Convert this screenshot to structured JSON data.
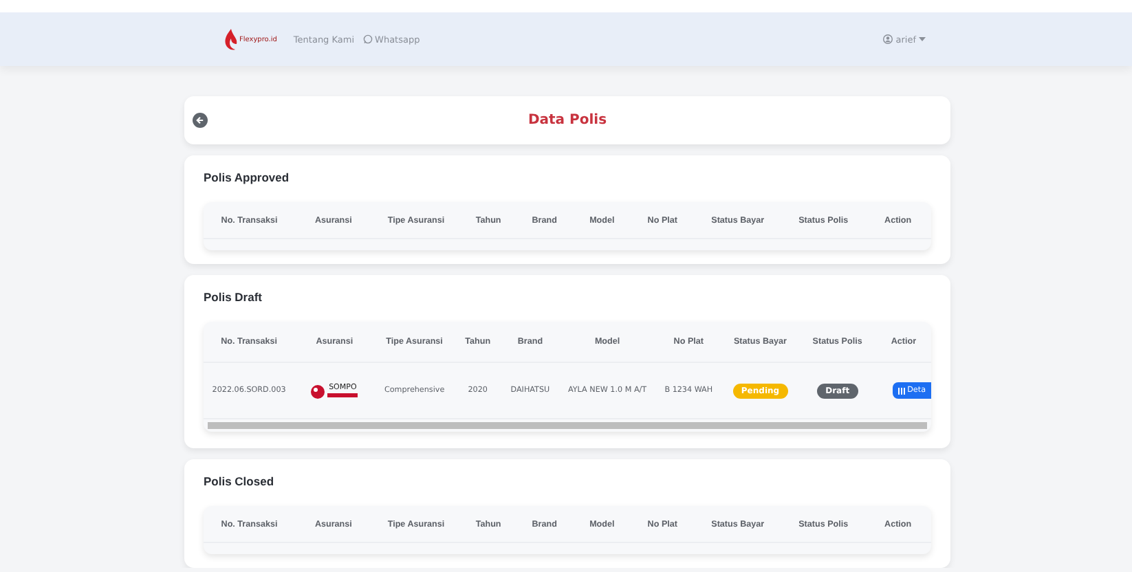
{
  "navbar": {
    "logo_text": "Flexypro.id",
    "links": [
      {
        "label": "Tentang Kami"
      },
      {
        "label": "Whatsapp"
      }
    ],
    "user": "arief"
  },
  "page_title": "Data Polis",
  "sections": [
    {
      "title": "Polis Approved",
      "columns": [
        "No. Transaksi",
        "Asuransi",
        "Tipe Asuransi",
        "Tahun",
        "Brand",
        "Model",
        "No Plat",
        "Status Bayar",
        "Status Polis",
        "Action"
      ]
    },
    {
      "title": "Polis Draft",
      "columns": [
        "No. Transaksi",
        "Asuransi",
        "Tipe Asuransi",
        "Tahun",
        "Brand",
        "Model",
        "No Plat",
        "Status Bayar",
        "Status Polis",
        "Actior"
      ],
      "rows": [
        {
          "no_transaksi": "2022.06.SORD.003",
          "asuransi": "SOMPO",
          "tipe": "Comprehensive",
          "tahun": "2020",
          "brand": "DAIHATSU",
          "model": "AYLA NEW 1.0 M A/T",
          "no_plat": "B 1234 WAH",
          "status_bayar": {
            "label": "Pending",
            "color": "#f5b800"
          },
          "status_polis": {
            "label": "Draft",
            "color": "#5f656c"
          },
          "action": "Deta"
        }
      ]
    },
    {
      "title": "Polis Closed",
      "columns": [
        "No. Transaksi",
        "Asuransi",
        "Tipe Asuransi",
        "Tahun",
        "Brand",
        "Model",
        "No Plat",
        "Status Bayar",
        "Status Polis",
        "Action"
      ]
    }
  ]
}
